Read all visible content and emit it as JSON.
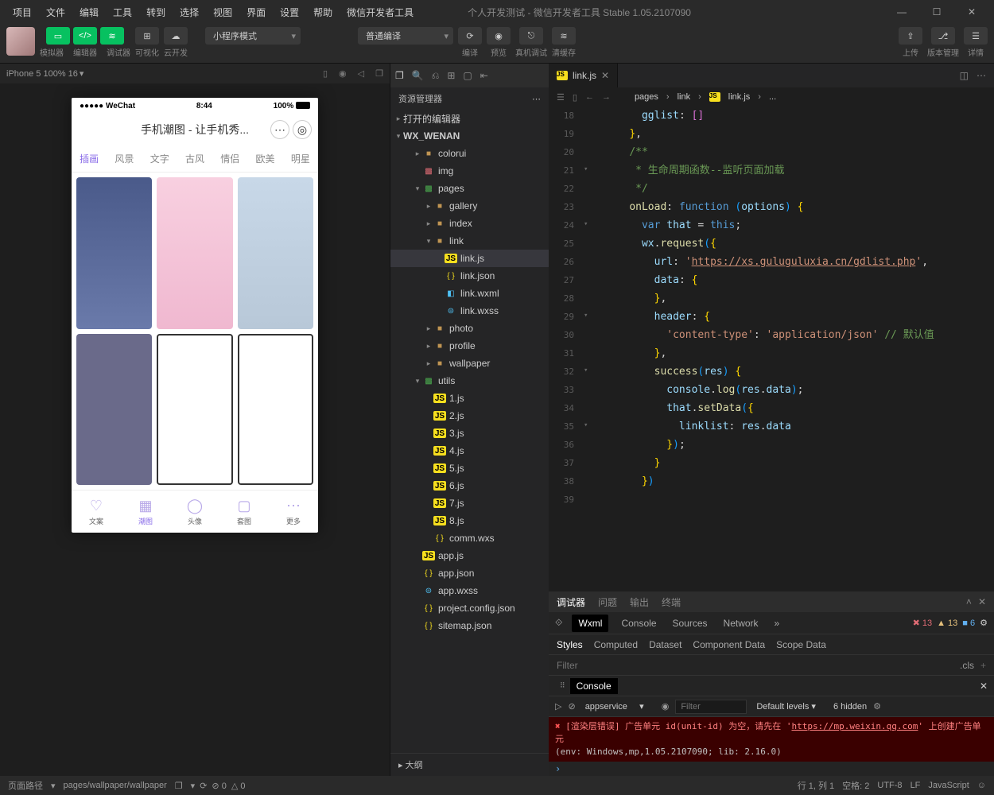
{
  "menubar": {
    "items": [
      "项目",
      "文件",
      "编辑",
      "工具",
      "转到",
      "选择",
      "视图",
      "界面",
      "设置",
      "帮助",
      "微信开发者工具"
    ]
  },
  "titlebar": {
    "title": "个人开发测试 - 微信开发者工具 Stable 1.05.2107090"
  },
  "toolbar": {
    "sim": "模拟器",
    "editor": "编辑器",
    "debugger": "调试器",
    "vis": "可视化",
    "cloud": "云开发",
    "mode": "小程序模式",
    "compile_mode": "普通编译",
    "compile": "编译",
    "preview": "预览",
    "realdbg": "真机调试",
    "clearcache": "清缓存",
    "upload": "上传",
    "version": "版本管理",
    "details": "详情"
  },
  "sim_header": {
    "device": "iPhone 5 100% 16",
    "chev": "▾"
  },
  "phone": {
    "signal": "●●●●● WeChat",
    "wifi": "ᯤ",
    "time": "8:44",
    "batt": "100%",
    "title": "手机潮图 - 让手机秀...",
    "tabs": [
      "插画",
      "风景",
      "文字",
      "古风",
      "情侣",
      "欧美",
      "明星"
    ],
    "bottom": [
      "文案",
      "潮图",
      "头像",
      "套图",
      "更多"
    ]
  },
  "filepanel": {
    "title": "资源管理器",
    "sections": {
      "opened": "打开的编辑器",
      "project": "WX_WENAN",
      "outline_label": "大纲"
    },
    "tree": [
      {
        "name": "colorui",
        "type": "folder",
        "depth": 2
      },
      {
        "name": "img",
        "type": "img2",
        "depth": 2
      },
      {
        "name": "pages",
        "type": "img",
        "depth": 2,
        "open": true
      },
      {
        "name": "gallery",
        "type": "folder",
        "depth": 3
      },
      {
        "name": "index",
        "type": "folder",
        "depth": 3
      },
      {
        "name": "link",
        "type": "folder",
        "depth": 3,
        "open": true
      },
      {
        "name": "link.js",
        "type": "js",
        "depth": 4,
        "selected": true
      },
      {
        "name": "link.json",
        "type": "json",
        "depth": 4
      },
      {
        "name": "link.wxml",
        "type": "wxml",
        "depth": 4
      },
      {
        "name": "link.wxss",
        "type": "wxss",
        "depth": 4
      },
      {
        "name": "photo",
        "type": "folder",
        "depth": 3
      },
      {
        "name": "profile",
        "type": "folder",
        "depth": 3
      },
      {
        "name": "wallpaper",
        "type": "folder",
        "depth": 3
      },
      {
        "name": "utils",
        "type": "img",
        "depth": 2,
        "open": true
      },
      {
        "name": "1.js",
        "type": "js",
        "depth": 3
      },
      {
        "name": "2.js",
        "type": "js",
        "depth": 3
      },
      {
        "name": "3.js",
        "type": "js",
        "depth": 3
      },
      {
        "name": "4.js",
        "type": "js",
        "depth": 3
      },
      {
        "name": "5.js",
        "type": "js",
        "depth": 3
      },
      {
        "name": "6.js",
        "type": "js",
        "depth": 3
      },
      {
        "name": "7.js",
        "type": "js",
        "depth": 3
      },
      {
        "name": "8.js",
        "type": "js",
        "depth": 3
      },
      {
        "name": "comm.wxs",
        "type": "json",
        "depth": 3
      },
      {
        "name": "app.js",
        "type": "js",
        "depth": 2
      },
      {
        "name": "app.json",
        "type": "json",
        "depth": 2
      },
      {
        "name": "app.wxss",
        "type": "wxss",
        "depth": 2
      },
      {
        "name": "project.config.json",
        "type": "json",
        "depth": 2
      },
      {
        "name": "sitemap.json",
        "type": "json",
        "depth": 2
      }
    ]
  },
  "editor": {
    "tab": "link.js",
    "breadcrumb": [
      "pages",
      "link",
      "link.js",
      "..."
    ],
    "line_start": 18,
    "lines": [
      [
        [
          "      ",
          "p"
        ],
        [
          "gglist",
          1
        ],
        [
          ": ",
          "p"
        ],
        [
          "[]",
          "br"
        ]
      ],
      [
        [
          "    ",
          "p"
        ],
        [
          "}",
          "b"
        ],
        [
          ",",
          "p"
        ]
      ],
      [
        [
          ""
        ]
      ],
      [
        [
          "    ",
          "p"
        ],
        [
          "/**",
          2
        ]
      ],
      [
        [
          "     * 生命周期函数--监听页面加载",
          2
        ]
      ],
      [
        [
          "     */",
          2
        ]
      ],
      [
        [
          "    ",
          "p"
        ],
        [
          "onLoad",
          5
        ],
        [
          ": ",
          "p"
        ],
        [
          "function",
          4
        ],
        [
          " ",
          "p"
        ],
        [
          "(",
          6
        ],
        [
          "options",
          1
        ],
        [
          ")",
          6
        ],
        [
          " ",
          "p"
        ],
        [
          "{",
          "b"
        ]
      ],
      [
        [
          "      ",
          "p"
        ],
        [
          "var",
          4
        ],
        [
          " ",
          "p"
        ],
        [
          "that",
          1
        ],
        [
          " = ",
          "p"
        ],
        [
          "this",
          4
        ],
        [
          ";",
          "p"
        ]
      ],
      [
        [
          "      ",
          "p"
        ],
        [
          "wx",
          1
        ],
        [
          ".",
          "p"
        ],
        [
          "request",
          5
        ],
        [
          "(",
          6
        ],
        [
          "{",
          "b"
        ]
      ],
      [
        [
          "        ",
          "p"
        ],
        [
          "url",
          1
        ],
        [
          ": ",
          "p"
        ],
        [
          "'",
          3
        ],
        [
          "https://xs.guluguluxia.cn/gdlist.php",
          8
        ],
        [
          "'",
          3
        ],
        [
          ",",
          "p"
        ]
      ],
      [
        [
          "        ",
          "p"
        ],
        [
          "data",
          1
        ],
        [
          ": ",
          "p"
        ],
        [
          "{",
          "b"
        ]
      ],
      [
        [
          "        ",
          "p"
        ],
        [
          "}",
          "b"
        ],
        [
          ",",
          "p"
        ]
      ],
      [
        [
          "        ",
          "p"
        ],
        [
          "header",
          1
        ],
        [
          ": ",
          "p"
        ],
        [
          "{",
          "b"
        ]
      ],
      [
        [
          "          ",
          "p"
        ],
        [
          "'content-type'",
          3
        ],
        [
          ": ",
          "p"
        ],
        [
          "'application/json'",
          3
        ],
        [
          " ",
          "p"
        ],
        [
          "// 默认值",
          2
        ]
      ],
      [
        [
          "        ",
          "p"
        ],
        [
          "}",
          "b"
        ],
        [
          ",",
          "p"
        ]
      ],
      [
        [
          "        ",
          "p"
        ],
        [
          "success",
          5
        ],
        [
          "(",
          6
        ],
        [
          "res",
          1
        ],
        [
          ")",
          6
        ],
        [
          " ",
          "p"
        ],
        [
          "{",
          "b"
        ]
      ],
      [
        [
          "          ",
          "p"
        ],
        [
          "console",
          1
        ],
        [
          ".",
          "p"
        ],
        [
          "log",
          5
        ],
        [
          "(",
          6
        ],
        [
          "res",
          1
        ],
        [
          ".",
          "p"
        ],
        [
          "data",
          1
        ],
        [
          ")",
          6
        ],
        [
          ";",
          "p"
        ]
      ],
      [
        [
          "          ",
          "p"
        ],
        [
          "that",
          1
        ],
        [
          ".",
          "p"
        ],
        [
          "setData",
          5
        ],
        [
          "(",
          6
        ],
        [
          "{",
          "b"
        ]
      ],
      [
        [
          "            ",
          "p"
        ],
        [
          "linklist",
          1
        ],
        [
          ": ",
          "p"
        ],
        [
          "res",
          1
        ],
        [
          ".",
          "p"
        ],
        [
          "data",
          1
        ]
      ],
      [
        [
          "          ",
          "p"
        ],
        [
          "}",
          "b"
        ],
        [
          ")",
          6
        ],
        [
          ";",
          "p"
        ]
      ],
      [
        [
          "        ",
          "p"
        ],
        [
          "}",
          "b"
        ]
      ],
      [
        [
          "      ",
          "p"
        ],
        [
          "}",
          "b"
        ],
        [
          ")",
          6
        ]
      ]
    ],
    "fold_marks": {
      "21": "▾",
      "24": "▾",
      "29": "▾",
      "32": "▾",
      "35": "▾"
    }
  },
  "debugger": {
    "tabs": [
      "调试器",
      "问题",
      "输出",
      "终端"
    ],
    "dt_tabs": [
      "Wxml",
      "Console",
      "Sources",
      "Network"
    ],
    "dt_more": "»",
    "badges": {
      "err": "13",
      "warn": "13",
      "info": "6"
    },
    "styles_tabs": [
      "Styles",
      "Computed",
      "Dataset",
      "Component Data",
      "Scope Data"
    ],
    "filter_placeholder": "Filter",
    "cls": ".cls",
    "console_title": "Console",
    "context": "appservice",
    "filter2_placeholder": "Filter",
    "levels": "Default levels",
    "hidden": "6 hidden",
    "err_prefix": "[渲染层错误] 广告单元 id(unit-id) 为空，请先在 '",
    "err_url": "https://mp.weixin.qq.com",
    "err_suffix": "' 上创建广告单元",
    "env": "(env: Windows,mp,1.05.2107090; lib: 2.16.0)"
  },
  "footer": {
    "path_label": "页面路径",
    "path": "pages/wallpaper/wallpaper",
    "errcount": "0",
    "warncount": "0",
    "pos": "行 1, 列 1",
    "spaces": "空格: 2",
    "enc": "UTF-8",
    "eol": "LF",
    "lang": "JavaScript"
  }
}
